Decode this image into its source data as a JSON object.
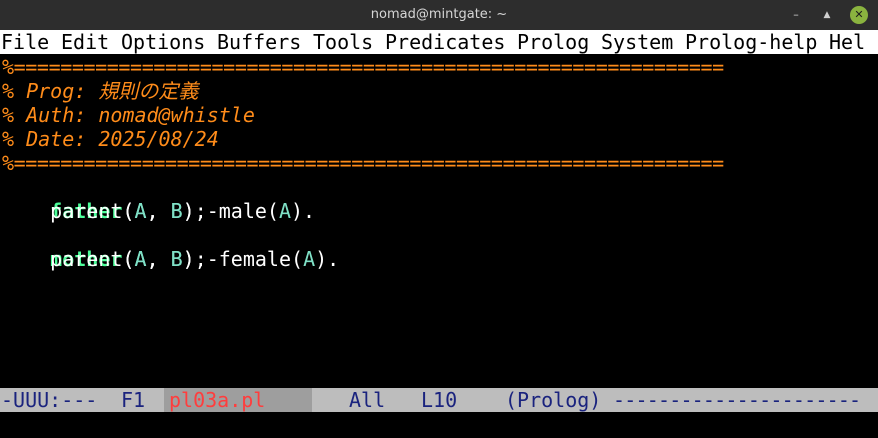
{
  "window": {
    "title": "nomad@mintgate: ~"
  },
  "menu": [
    "File",
    "Edit",
    "Options",
    "Buffers",
    "Tools",
    "Predicates",
    "Prolog",
    "System",
    "Prolog-help",
    "Hel"
  ],
  "editor": {
    "separator_top": "%=============================================================",
    "comment_prog": "% Prog: 規則の定義",
    "comment_auth": "% Auth: nomad@whistle",
    "comment_date": "% Date: 2025/08/24",
    "separator_bottom": "%=============================================================",
    "rule1_head": "father",
    "rule1_args": "(A, B):-",
    "rule1_body": "    parent(A, B), male(A).",
    "rule2_head": "mother",
    "rule2_args": "(A, B):-",
    "rule2_body": "    parent(A, B), female(A)."
  },
  "modeline": {
    "status": "-UUU:---",
    "frame": "F1",
    "buffer_name": "pl03a.pl",
    "position": "All",
    "line": "L10",
    "mode": "(Prolog)",
    "fill": "----------------------"
  },
  "colors": {
    "comment": "#ff8c1a",
    "rule_head": "#4cff9a",
    "variable": "#7fe0c6",
    "modeline_bg": "#bdbdbd",
    "modeline_text": "#1a237e",
    "buffer_name": "#ff3d3d",
    "close_button": "#8ab33f"
  },
  "icons": [
    "minimize-icon",
    "maximize-icon",
    "close-icon"
  ]
}
